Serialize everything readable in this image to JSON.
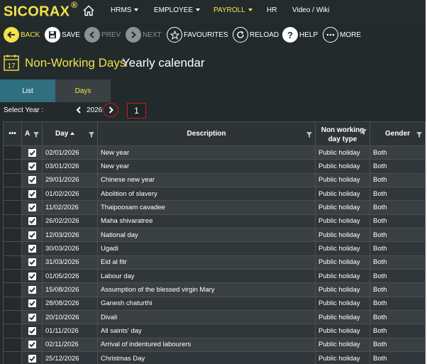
{
  "app": {
    "logo": "SICORAX",
    "logo_mark": "®"
  },
  "nav": {
    "items": [
      {
        "label": "HRMS",
        "has_caret": true
      },
      {
        "label": "EMPLOYEE",
        "has_caret": true
      },
      {
        "label": "PAYROLL",
        "has_caret": true,
        "active": true
      },
      {
        "label": "HR",
        "has_caret": false
      },
      {
        "label": "Video / Wiki",
        "has_caret": false
      }
    ]
  },
  "toolbar": {
    "back": "BACK",
    "save": "SAVE",
    "prev": "PREV",
    "next": "NEXT",
    "favourites": "FAVOURITES",
    "reload": "RELOAD",
    "help": "HELP",
    "more": "MORE"
  },
  "page": {
    "title": "Non-Working Days",
    "subtitle": "Yearly calendar",
    "calendar_icon_day": "17"
  },
  "tabs": {
    "list": "List",
    "days": "Days"
  },
  "year": {
    "label": "Select Year :",
    "value": "2026",
    "marker": "1"
  },
  "grid": {
    "columns": {
      "menu": "•••",
      "active": "A",
      "day": "Day",
      "description": "Description",
      "type_line1": "Non working",
      "type_line2": "day type",
      "gender": "Gender"
    },
    "rows": [
      {
        "day": "02/01/2026",
        "description": "New year",
        "type": "Public holiday",
        "gender": "Both"
      },
      {
        "day": "03/01/2026",
        "description": "New year",
        "type": "Public holiday",
        "gender": "Both"
      },
      {
        "day": "29/01/2026",
        "description": "Chinese new year",
        "type": "Public holiday",
        "gender": "Both"
      },
      {
        "day": "01/02/2026",
        "description": "Abolition of slavery",
        "type": "Public holiday",
        "gender": "Both"
      },
      {
        "day": "11/02/2026",
        "description": "Thaipoosam cavadee",
        "type": "Public holiday",
        "gender": "Both"
      },
      {
        "day": "26/02/2026",
        "description": "Maha shivaratree",
        "type": "Public holiday",
        "gender": "Both"
      },
      {
        "day": "12/03/2026",
        "description": "National day",
        "type": "Public holiday",
        "gender": "Both"
      },
      {
        "day": "30/03/2026",
        "description": "Ugadi",
        "type": "Public holiday",
        "gender": "Both"
      },
      {
        "day": "31/03/2026",
        "description": "Eid al fitr",
        "type": "Public holiday",
        "gender": "Both"
      },
      {
        "day": "01/05/2026",
        "description": "Labour day",
        "type": "Public holiday",
        "gender": "Both"
      },
      {
        "day": "15/08/2026",
        "description": "Assumption of the blessed virgin Mary",
        "type": "Public holiday",
        "gender": "Both"
      },
      {
        "day": "28/08/2026",
        "description": "Ganesh chaturthi",
        "type": "Public holiday",
        "gender": "Both"
      },
      {
        "day": "20/10/2026",
        "description": "Divali",
        "type": "Public holiday",
        "gender": "Both"
      },
      {
        "day": "01/11/2026",
        "description": "All saints' day",
        "type": "Public holiday",
        "gender": "Both"
      },
      {
        "day": "02/11/2026",
        "description": "Arrival of indentured labourers",
        "type": "Public holiday",
        "gender": "Both"
      },
      {
        "day": "25/12/2026",
        "description": "Christmas Day",
        "type": "Public holiday",
        "gender": "Both"
      }
    ]
  },
  "colors": {
    "accent": "#f2e34a",
    "background": "#232a2c",
    "tab_active": "#2f6f80",
    "highlight": "#c41b1b"
  }
}
